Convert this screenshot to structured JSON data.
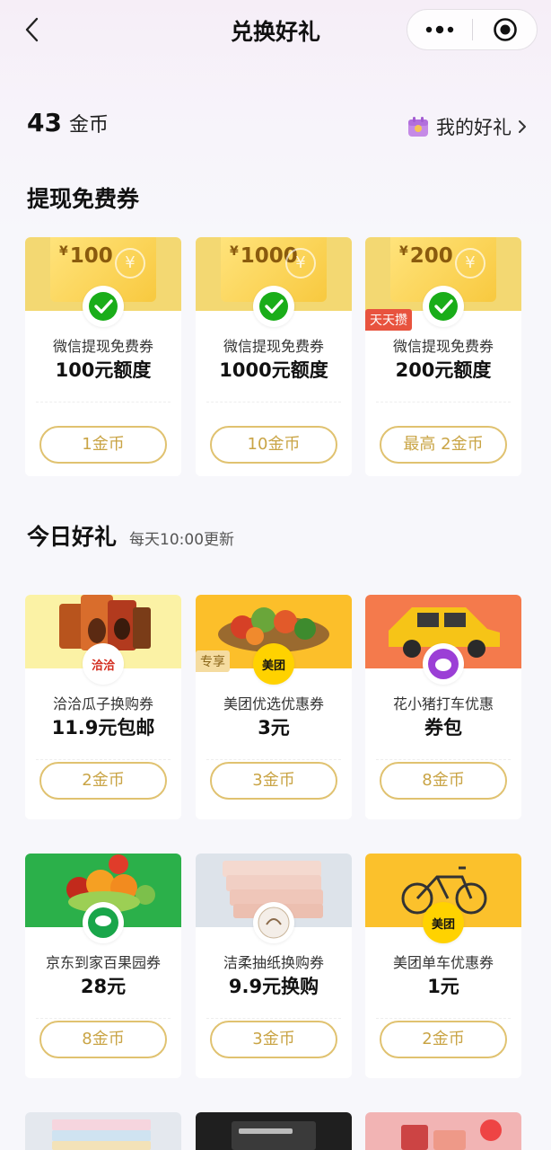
{
  "nav": {
    "title": "兑换好礼"
  },
  "wallet": {
    "coins": "43",
    "coins_unit": "金币",
    "my_gifts": "我的好礼"
  },
  "sections": {
    "cash": "提现免费券",
    "today": "今日好礼",
    "today_sub": "每天10:00更新"
  },
  "cash_cards": [
    {
      "face": "100",
      "name": "微信提现免费券",
      "amount": "100元额度",
      "button": "1金币"
    },
    {
      "face": "1000",
      "name": "微信提现免费券",
      "amount": "1000元额度",
      "button": "10金币"
    },
    {
      "face": "200",
      "name": "微信提现免费券",
      "amount": "200元额度",
      "button": "最高 2金币",
      "tag": "天天攒"
    }
  ],
  "gift_cards": [
    {
      "name": "洽洽瓜子换购券",
      "detail": "11.9元包邮",
      "button": "2金币",
      "logo": "洽洽"
    },
    {
      "name": "美团优选优惠券",
      "detail": "3元",
      "button": "3金币",
      "tag": "专享",
      "logo": "美团"
    },
    {
      "name": "花小猪打车优惠",
      "detail": "券包",
      "button": "8金币"
    },
    {
      "name": "京东到家百果园券",
      "detail": "28元",
      "button": "8金币"
    },
    {
      "name": "洁柔抽纸换购券",
      "detail": "9.9元换购",
      "button": "3金币"
    },
    {
      "name": "美团单车优惠券",
      "detail": "1元",
      "button": "2金币",
      "logo": "美团"
    }
  ],
  "colors": {
    "gold_border": "#e0c270",
    "gold_text": "#c9a445",
    "voucher_yellow": "#f3d872",
    "wechat_green": "#1aad19",
    "tag_red": "#e8533e",
    "tag_gold": "#f5dca0"
  },
  "icons": {
    "back": "chevron-left-icon",
    "more": "more-dots-icon",
    "close": "target-close-icon",
    "gift": "gift-box-icon",
    "wechat": "wechat-icon"
  }
}
